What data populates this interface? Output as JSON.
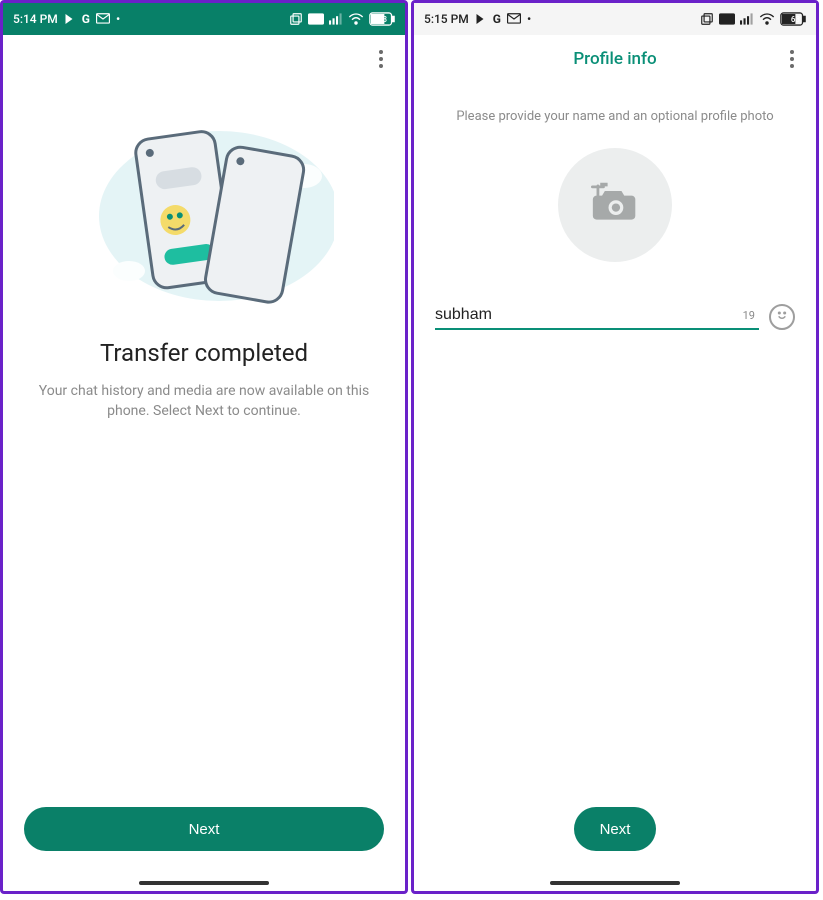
{
  "left": {
    "status": {
      "time": "5:14 PM",
      "battery": "63"
    },
    "kebab_name": "more-options",
    "heading": "Transfer completed",
    "subtext": "Your chat history and media are now available on this phone. Select Next to continue.",
    "next_label": "Next"
  },
  "right": {
    "status": {
      "time": "5:15 PM",
      "battery": "63"
    },
    "title": "Profile info",
    "kebab_name": "more-options",
    "instruction": "Please provide your name and an optional profile photo",
    "name_value": "subham",
    "char_remaining": "19",
    "next_label": "Next"
  },
  "icons": {
    "play": "play-store-icon",
    "google": "google-icon",
    "gmail": "gmail-icon",
    "copy": "multi-window-icon",
    "lte": "lte-badge-icon",
    "signal": "signal-icon",
    "wifi": "wifi-icon",
    "battery": "battery-icon",
    "camera": "add-photo-icon",
    "emoji": "emoji-icon"
  }
}
